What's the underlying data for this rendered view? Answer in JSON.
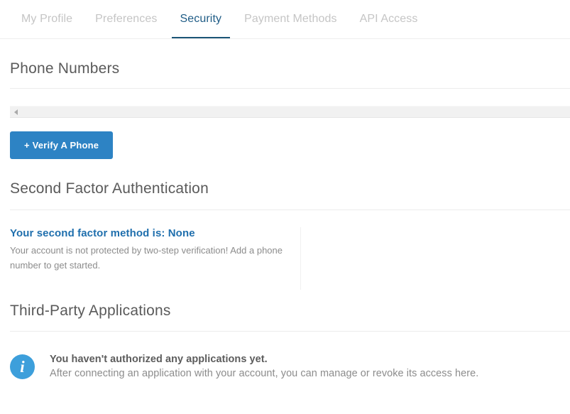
{
  "tabs": [
    {
      "label": "My Profile",
      "active": false
    },
    {
      "label": "Preferences",
      "active": false
    },
    {
      "label": "Security",
      "active": true
    },
    {
      "label": "Payment Methods",
      "active": false
    },
    {
      "label": "API Access",
      "active": false
    }
  ],
  "phone_section": {
    "title": "Phone Numbers",
    "scrollbar": {
      "left_arrow_icon": "triangle-left-icon"
    },
    "verify_button": "+ Verify A Phone"
  },
  "second_factor_section": {
    "title": "Second Factor Authentication",
    "status": "Your second factor method is: None",
    "description": "Your account is not protected by two-step verification! Add a phone number to get started."
  },
  "third_party_section": {
    "title": "Third-Party Applications",
    "notice": {
      "icon": "info-circle-icon",
      "title": "You haven't authorized any applications yet.",
      "subtitle": "After connecting an application with your account, you can manage or revoke its access here."
    }
  },
  "colors": {
    "active_tab": "#1f5c86",
    "inactive_tab": "#c5c5c5",
    "tab_underline": "#1b5576",
    "primary_button": "#2d83c4",
    "status_link": "#1f6fad",
    "info_icon": "#3d9fdb",
    "rule": "#ececec"
  }
}
